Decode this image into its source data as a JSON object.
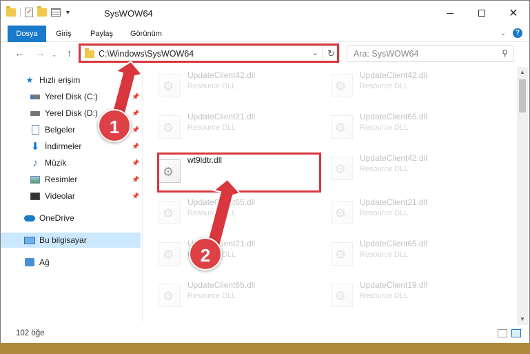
{
  "window": {
    "title": "SysWOW64",
    "controls": {
      "minimize": "minimize-icon",
      "maximize": "maximize-icon",
      "close": "✕"
    }
  },
  "ribbon": {
    "tabs": [
      {
        "label": "Dosya",
        "active": true
      },
      {
        "label": "Giriş"
      },
      {
        "label": "Paylaş"
      },
      {
        "label": "Görünüm"
      }
    ],
    "help": "?"
  },
  "nav": {
    "address": "C:\\Windows\\SysWOW64",
    "search_placeholder": "Ara: SysWOW64"
  },
  "sidebar": {
    "quick_access": "Hızlı erişim",
    "items": [
      {
        "label": "Yerel Disk (C:)",
        "icon": "drive-c-icon",
        "pinned": true
      },
      {
        "label": "Yerel Disk (D:)",
        "icon": "drive-d-icon",
        "pinned": true
      },
      {
        "label": "Belgeler",
        "icon": "documents-icon",
        "pinned": true
      },
      {
        "label": "İndirmeler",
        "icon": "downloads-icon",
        "pinned": true
      },
      {
        "label": "Müzik",
        "icon": "music-icon",
        "pinned": true
      },
      {
        "label": "Resimler",
        "icon": "pictures-icon",
        "pinned": true
      },
      {
        "label": "Videolar",
        "icon": "videos-icon",
        "pinned": true
      }
    ],
    "onedrive": "OneDrive",
    "this_pc": "Bu bilgisayar",
    "network": "Ağ"
  },
  "files": [
    {
      "name": "UpdateClient42.dll",
      "type": "Resource DLL",
      "faded": true
    },
    {
      "name": "UpdateClient42.dll",
      "type": "Resource DLL",
      "faded": true
    },
    {
      "name": "UpdateClient21.dll",
      "type": "Resource DLL",
      "faded": true
    },
    {
      "name": "UpdateClient65.dll",
      "type": "Resource DLL",
      "faded": true
    },
    {
      "name": "wt9ldtr.dll",
      "type": "",
      "faded": false
    },
    {
      "name": "UpdateClient42.dll",
      "type": "Resource DLL",
      "faded": true
    },
    {
      "name": "UpdateClient65.dll",
      "type": "Resource DLL",
      "faded": true
    },
    {
      "name": "UpdateClient21.dll",
      "type": "Resource DLL",
      "faded": true
    },
    {
      "name": "UpdateClient21.dll",
      "type": "Resource DLL",
      "faded": true
    },
    {
      "name": "UpdateClient65.dll",
      "type": "Resource DLL",
      "faded": true
    },
    {
      "name": "UpdateClient65.dll",
      "type": "Resource DLL",
      "faded": true
    },
    {
      "name": "UpdateClient19.dll",
      "type": "Resource DLL",
      "faded": true
    }
  ],
  "status": {
    "count": "102 öğe"
  },
  "annotations": {
    "step1": "1",
    "step2": "2",
    "color": "#d9363e"
  }
}
